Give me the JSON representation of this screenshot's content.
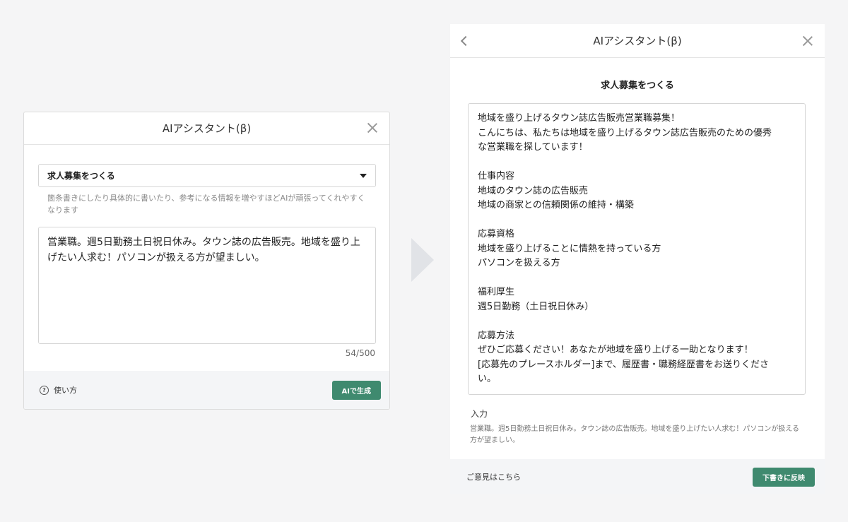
{
  "left_dialog": {
    "title": "AIアシスタント(β)",
    "close_icon": "close-icon",
    "template_select": {
      "value": "求人募集をつくる",
      "icon": "caret-down-icon"
    },
    "helper_text": "箇条書きにしたり具体的に書いたり、参考になる情報を増やすほどAIが頑張ってくれやすくなります",
    "prompt_text": "営業職。週5日勤務土日祝日休み。タウン誌の広告販売。地域を盛り上げたい人求む！パソコンが扱える方が望ましい。",
    "char_counter": "54/500",
    "help_icon": "question-circle-icon",
    "help_label": "使い方",
    "generate_button": "AIで生成"
  },
  "right_dialog": {
    "title": "AIアシスタント(β)",
    "back_icon": "chevron-left-icon",
    "close_icon": "close-icon",
    "heading": "求人募集をつくる",
    "output": {
      "l1": "地域を盛り上げるタウン誌広告販売営業職募集！",
      "l2": "こんにちは、私たちは地域を盛り上げるタウン誌広告販売のための優秀",
      "l3": "な営業職を探しています！",
      "l4": "仕事内容",
      "l5": "地域のタウン誌の広告販売",
      "l6": "地域の商家との信頼関係の維持・構築",
      "l7": "応募資格",
      "l8": "地域を盛り上げることに情熱を持っている方",
      "l9": "パソコンを扱える方",
      "l10": "福利厚生",
      "l11": "週5日勤務（土日祝日休み）",
      "l12": "応募方法",
      "l13": "ぜひご応募ください！あなたが地域を盛り上げる一助となります！",
      "l14": "[応募先のプレースホルダー]まで、履歴書・職務経歴書をお送りくださ",
      "l15": "い。"
    },
    "input_label": "入力",
    "input_text": "営業職。週5日勤務土日祝日休み。タウン誌の広告販売。地域を盛り上げたい人求む！パソコンが扱える方が望ましい。",
    "feedback_link": "ご意見はこちら",
    "apply_button": "下書きに反映"
  },
  "colors": {
    "accent_green": "#3f8a6f",
    "arrow": "#e1e3e7",
    "footer_bg": "#f4f5f7"
  },
  "arrow_icon": "right-arrow-icon"
}
